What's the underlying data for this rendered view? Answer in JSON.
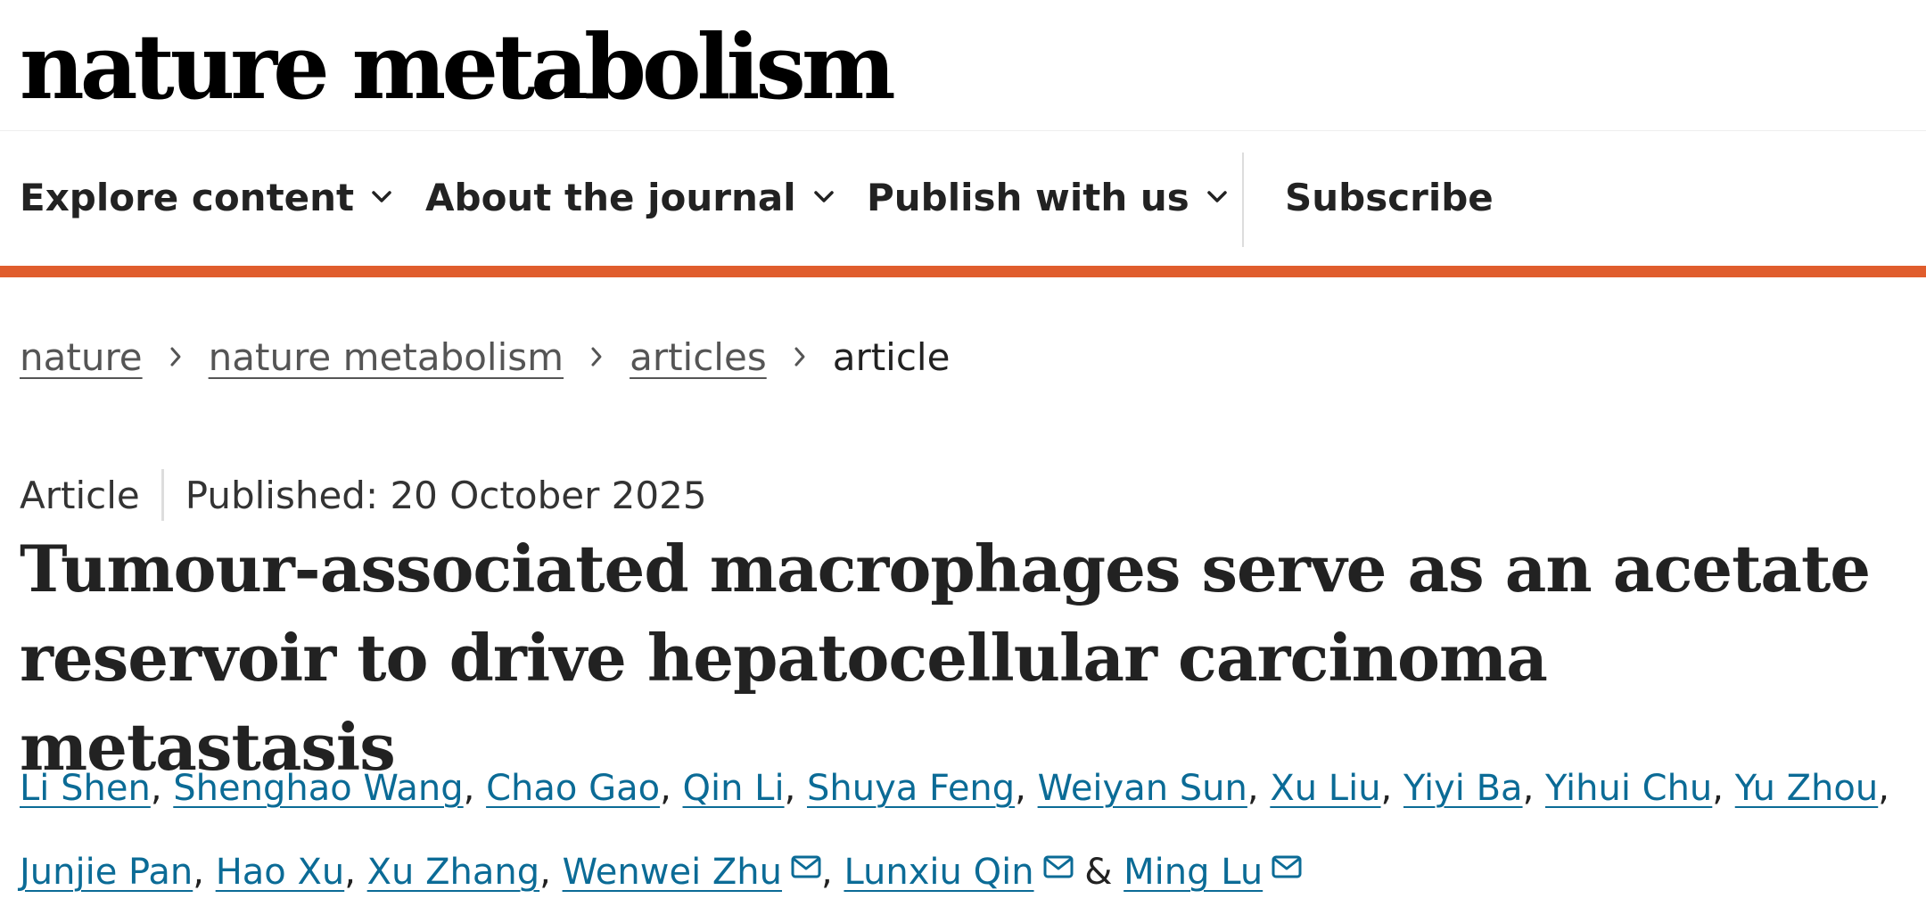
{
  "site": {
    "logo_text": "nature metabolism"
  },
  "nav": {
    "explore_label": "Explore content",
    "about_label": "About the journal",
    "publish_label": "Publish with us",
    "subscribe_label": "Subscribe"
  },
  "breadcrumb": {
    "items": [
      "nature",
      "nature metabolism",
      "articles"
    ],
    "current": "article"
  },
  "article": {
    "type": "Article",
    "published": "Published: 20 October 2025",
    "title": "Tumour-associated macrophages serve as an acetate reservoir to drive hepatocellular carcinoma metastasis"
  },
  "authors": [
    {
      "name": "Li Shen",
      "mail": false
    },
    {
      "name": "Shenghao Wang",
      "mail": false
    },
    {
      "name": "Chao Gao",
      "mail": false
    },
    {
      "name": "Qin Li",
      "mail": false
    },
    {
      "name": "Shuya Feng",
      "mail": false
    },
    {
      "name": "Weiyan Sun",
      "mail": false
    },
    {
      "name": "Xu Liu",
      "mail": false
    },
    {
      "name": "Yiyi Ba",
      "mail": false
    },
    {
      "name": "Yihui Chu",
      "mail": false
    },
    {
      "name": "Yu Zhou",
      "mail": false
    },
    {
      "name": "Junjie Pan",
      "mail": false
    },
    {
      "name": "Hao Xu",
      "mail": false
    },
    {
      "name": "Xu Zhang",
      "mail": false
    },
    {
      "name": "Wenwei Zhu",
      "mail": true
    },
    {
      "name": "Lunxiu Qin",
      "mail": true
    },
    {
      "name": "Ming Lu",
      "mail": true
    }
  ],
  "authors_separator": ",",
  "authors_last_separator": "&",
  "colors": {
    "accent": "#e05d2d",
    "link": "#0b6b96",
    "text": "#222222"
  }
}
